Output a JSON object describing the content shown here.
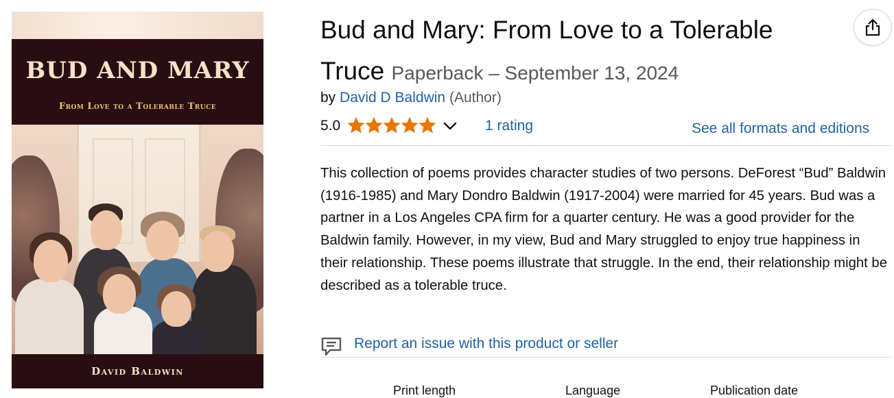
{
  "cover": {
    "title": "BUD AND MARY",
    "subtitle": "From Love to a Tolerable Truce",
    "author": "David Baldwin"
  },
  "product": {
    "title": "Bud and Mary: From Love to a Tolerable Truce",
    "format": "Paperback",
    "date_separator": "–",
    "date": "September 13, 2024",
    "by_label": "by",
    "author": "David D Baldwin",
    "author_role": "(Author)"
  },
  "rating": {
    "value": "5.0",
    "stars": 5,
    "count_text": "1 rating",
    "star_color": "#e77600"
  },
  "formats_link": "See all formats and editions",
  "description": "This collection of poems provides character studies of two persons. DeForest “Bud” Baldwin (1916-1985) and Mary Dondro Baldwin (1917-2004) were married for 45 years. Bud was a partner in a Los Angeles CPA firm for a quarter century. He was a good provider for the Baldwin family. However, in my view, Bud and Mary struggled to enjoy true happiness in their relationship. These poems illustrate that struggle. In the end, their relationship might be described as a tolerable truce.",
  "report": {
    "icon": "feedback-icon",
    "label": "Report an issue with this product or seller"
  },
  "details": {
    "labels": [
      "Print length",
      "Language",
      "Publication date"
    ]
  },
  "icons": {
    "share": "share-icon",
    "chevron": "chevron-down-icon"
  },
  "colors": {
    "link": "#2162a1",
    "muted": "#565959",
    "cover_band": "#2a0d12"
  }
}
